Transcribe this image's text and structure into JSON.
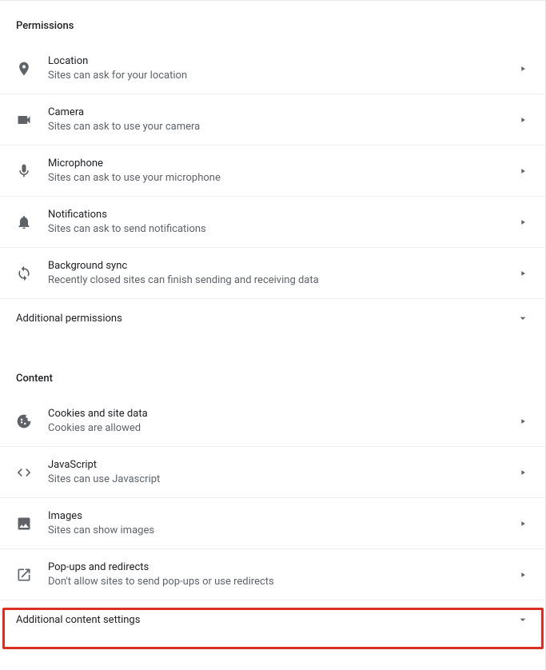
{
  "sections": {
    "permissions": {
      "header": "Permissions",
      "items": [
        {
          "title": "Location",
          "subtitle": "Sites can ask for your location"
        },
        {
          "title": "Camera",
          "subtitle": "Sites can ask to use your camera"
        },
        {
          "title": "Microphone",
          "subtitle": "Sites can ask to use your microphone"
        },
        {
          "title": "Notifications",
          "subtitle": "Sites can ask to send notifications"
        },
        {
          "title": "Background sync",
          "subtitle": "Recently closed sites can finish sending and receiving data"
        }
      ],
      "expand": "Additional permissions"
    },
    "content": {
      "header": "Content",
      "items": [
        {
          "title": "Cookies and site data",
          "subtitle": "Cookies are allowed"
        },
        {
          "title": "JavaScript",
          "subtitle": "Sites can use Javascript"
        },
        {
          "title": "Images",
          "subtitle": "Sites can show images"
        },
        {
          "title": "Pop-ups and redirects",
          "subtitle": "Don't allow sites to send pop-ups or use redirects"
        }
      ],
      "expand": "Additional content settings"
    }
  }
}
